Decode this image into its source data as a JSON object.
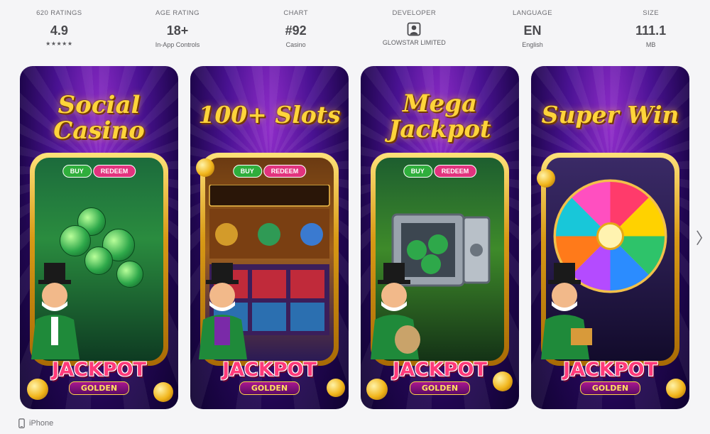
{
  "info": [
    {
      "label": "620 RATINGS",
      "value": "4.9",
      "sub": "★★★★★"
    },
    {
      "label": "AGE RATING",
      "value": "18+",
      "sub": "In-App Controls"
    },
    {
      "label": "CHART",
      "value": "#92",
      "sub": "Casino"
    },
    {
      "label": "DEVELOPER",
      "icon": "person-icon",
      "sub": "GLOWSTAR LIMITED"
    },
    {
      "label": "LANGUAGE",
      "value": "EN",
      "sub": "English"
    },
    {
      "label": "SIZE",
      "value": "111.1",
      "sub": "MB"
    }
  ],
  "screenshots": [
    {
      "headline_1": "Social",
      "headline_2": "Casino",
      "buy": "BUY",
      "redeem": "REDEEM",
      "jackpot_top": "JACKPOT",
      "jackpot_bottom": "GOLDEN"
    },
    {
      "headline_1": "100+ Slots",
      "headline_2": "",
      "buy": "BUY",
      "redeem": "REDEEM",
      "jackpot_top": "JACKPOT",
      "jackpot_bottom": "GOLDEN"
    },
    {
      "headline_1": "Mega",
      "headline_2": "Jackpot",
      "buy": "BUY",
      "redeem": "REDEEM",
      "jackpot_top": "JACKPOT",
      "jackpot_bottom": "GOLDEN"
    },
    {
      "headline_1": "Super Win",
      "headline_2": "",
      "buy": "",
      "redeem": "",
      "jackpot_top": "JACKPOT",
      "jackpot_bottom": "GOLDEN"
    }
  ],
  "nav": {
    "next": "〉"
  },
  "platform": {
    "icon": "iphone-icon",
    "label": "iPhone"
  },
  "colors": {
    "background": "#f5f5f7",
    "headline": "#ffd43a",
    "buy": "#2fae3c",
    "redeem": "#e2337e"
  }
}
